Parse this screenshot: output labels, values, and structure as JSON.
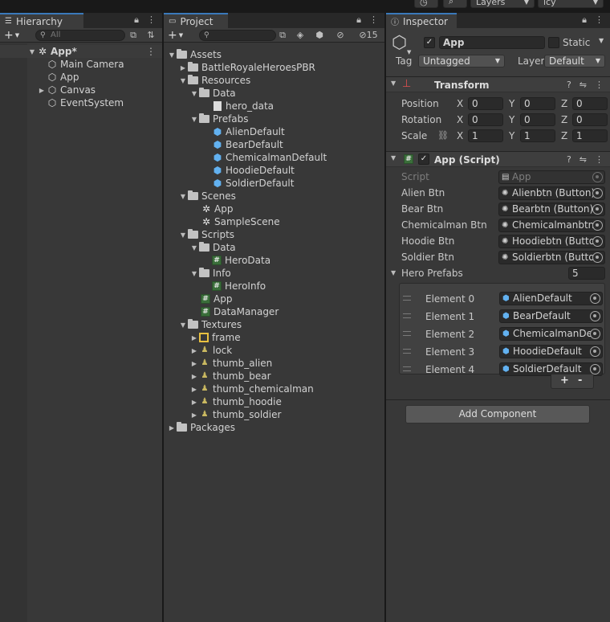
{
  "toolbar": {
    "layers_label": "Layers",
    "layout_label": "icy"
  },
  "hierarchy": {
    "tab_label": "Hierarchy",
    "search_placeholder": "All",
    "scene_name": "App*",
    "items": [
      {
        "label": "Main Camera"
      },
      {
        "label": "App"
      },
      {
        "label": "Canvas"
      },
      {
        "label": "EventSystem"
      }
    ]
  },
  "project": {
    "tab_label": "Project",
    "hidden_count": "15",
    "tree": [
      {
        "label": "Assets"
      },
      {
        "label": "BattleRoyaleHeroesPBR"
      },
      {
        "label": "Resources"
      },
      {
        "label": "Data"
      },
      {
        "label": "hero_data"
      },
      {
        "label": "Prefabs"
      },
      {
        "label": "AlienDefault"
      },
      {
        "label": "BearDefault"
      },
      {
        "label": "ChemicalmanDefault"
      },
      {
        "label": "HoodieDefault"
      },
      {
        "label": "SoldierDefault"
      },
      {
        "label": "Scenes"
      },
      {
        "label": "App"
      },
      {
        "label": "SampleScene"
      },
      {
        "label": "Scripts"
      },
      {
        "label": "Data"
      },
      {
        "label": "HeroData"
      },
      {
        "label": "Info"
      },
      {
        "label": "HeroInfo"
      },
      {
        "label": "App"
      },
      {
        "label": "DataManager"
      },
      {
        "label": "Textures"
      },
      {
        "label": "frame"
      },
      {
        "label": "lock"
      },
      {
        "label": "thumb_alien"
      },
      {
        "label": "thumb_bear"
      },
      {
        "label": "thumb_chemicalman"
      },
      {
        "label": "thumb_hoodie"
      },
      {
        "label": "thumb_soldier"
      },
      {
        "label": "Packages"
      }
    ]
  },
  "inspector": {
    "tab_label": "Inspector",
    "object_name": "App",
    "static_label": "Static",
    "tag_label": "Tag",
    "tag_value": "Untagged",
    "layer_label": "Layer",
    "layer_value": "Default",
    "transform": {
      "title": "Transform",
      "position_label": "Position",
      "rotation_label": "Rotation",
      "scale_label": "Scale",
      "x_label": "X",
      "y_label": "Y",
      "z_label": "Z",
      "position": [
        "0",
        "0",
        "0"
      ],
      "rotation": [
        "0",
        "0",
        "0"
      ],
      "scale": [
        "1",
        "1",
        "1"
      ]
    },
    "script_component": {
      "title": "App (Script)",
      "script_label": "Script",
      "script_value": "App",
      "fields": [
        {
          "label": "Alien Btn",
          "value": "Alienbtn (Button)"
        },
        {
          "label": "Bear Btn",
          "value": "Bearbtn (Button)"
        },
        {
          "label": "Chemicalman Btn",
          "value": "Chemicalmanbtn"
        },
        {
          "label": "Hoodie Btn",
          "value": "Hoodiebtn (Butto"
        },
        {
          "label": "Soldier Btn",
          "value": "Soldierbtn (Butto"
        }
      ],
      "hero_prefabs_label": "Hero Prefabs",
      "hero_prefabs_count": "5",
      "elements": [
        {
          "label": "Element 0",
          "value": "AlienDefault"
        },
        {
          "label": "Element 1",
          "value": "BearDefault"
        },
        {
          "label": "Element 2",
          "value": "ChemicalmanDe"
        },
        {
          "label": "Element 3",
          "value": "HoodieDefault"
        },
        {
          "label": "Element 4",
          "value": "SoldierDefault"
        }
      ],
      "add_label": "+",
      "remove_label": "-"
    },
    "add_component_label": "Add Component"
  },
  "colors": {
    "panel_bg": "#383838",
    "tab_accent": "#3a79bb",
    "prefab_blue": "#62b1f0"
  }
}
